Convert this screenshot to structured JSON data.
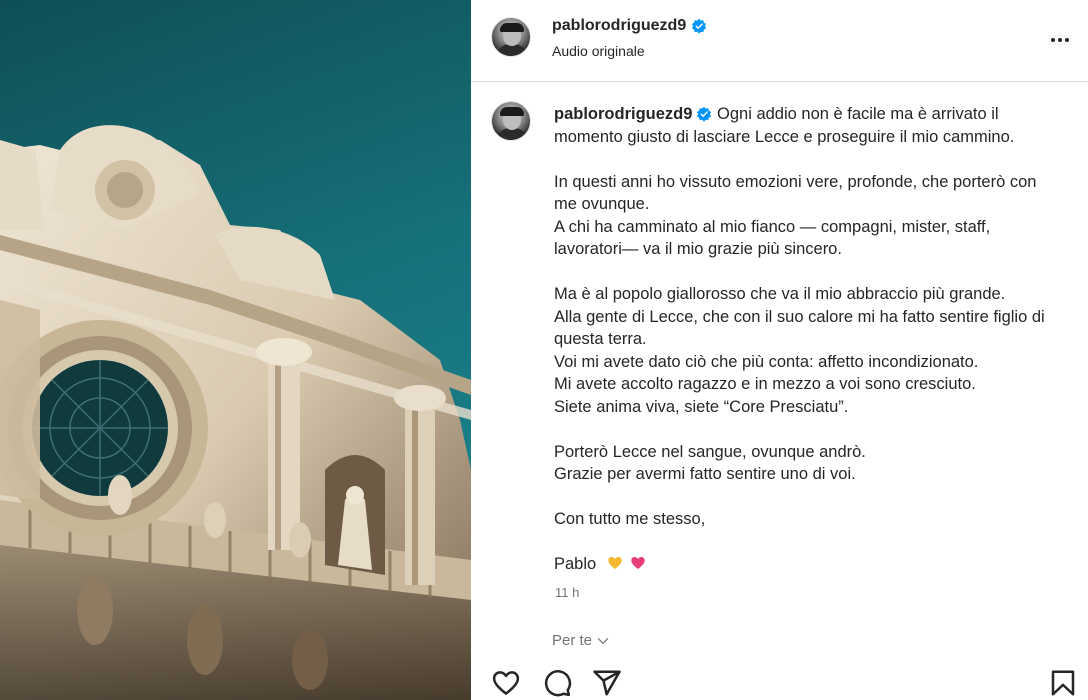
{
  "post": {
    "username": "pablorodriguezd9",
    "audio_label": "Audio originale",
    "more_icon": "more-horizontal-icon",
    "verified_color": "#0095f6",
    "caption": {
      "username": "pablorodriguezd9",
      "first_line": " Ogni addio non è facile ma è arrivato il momento giusto di lasciare Lecce e proseguire il mio cammino.",
      "p1_l1": "In questi anni ho vissuto emozioni vere, profonde, che porterò con me ovunque.",
      "p1_l2": "A chi ha camminato al mio fianco — compagni, mister, staff, lavoratori— va il mio grazie più sincero.",
      "p2_l1": "Ma è al popolo giallorosso che va il mio abbraccio più grande.",
      "p2_l2": "Alla gente di Lecce, che con il suo calore mi ha fatto sentire figlio di questa terra.",
      "p2_l3": "Voi mi avete dato ciò che più conta: affetto incondizionato.",
      "p2_l4": "Mi avete accolto ragazzo e in mezzo a voi sono cresciuto.",
      "p2_l5": "Siete anima viva, siete “Core Presciatu”.",
      "p3_l1": "Porterò Lecce nel sangue, ovunque andrò.",
      "p3_l2": "Grazie per avermi fatto sentire uno di voi.",
      "p4_l1": "Con tutto me stesso,",
      "signature": "Pablo",
      "emojis": [
        "yellow-heart-icon",
        "pink-heart-icon"
      ]
    },
    "time": "11 h",
    "see_translation": "Per te"
  },
  "actions": {
    "icons": [
      "heart-icon",
      "comment-icon",
      "share-icon",
      "bookmark-icon"
    ]
  }
}
